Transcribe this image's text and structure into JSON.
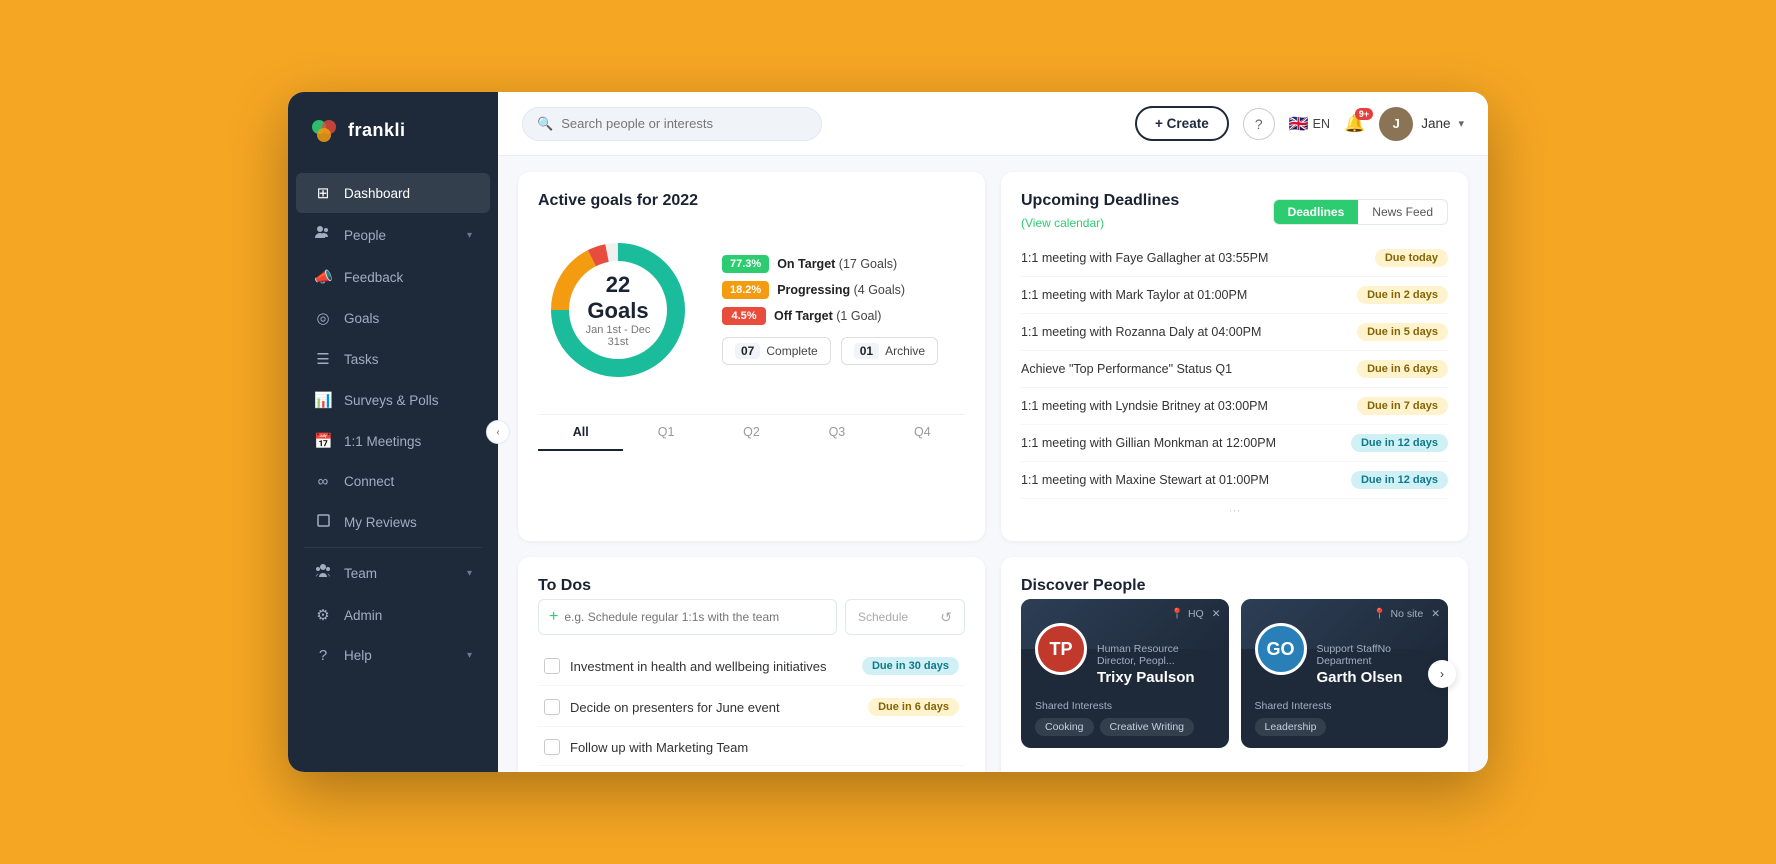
{
  "app": {
    "name": "frankli"
  },
  "header": {
    "search_placeholder": "Search people or interests",
    "create_label": "+ Create",
    "help_label": "?",
    "lang": "EN",
    "notifications_count": "9+",
    "user_name": "Jane"
  },
  "sidebar": {
    "items": [
      {
        "id": "dashboard",
        "label": "Dashboard",
        "icon": "⊞",
        "active": true
      },
      {
        "id": "people",
        "label": "People",
        "icon": "👥",
        "arrow": true
      },
      {
        "id": "feedback",
        "label": "Feedback",
        "icon": "📣"
      },
      {
        "id": "goals",
        "label": "Goals",
        "icon": "◎"
      },
      {
        "id": "tasks",
        "label": "Tasks",
        "icon": "☰"
      },
      {
        "id": "surveys",
        "label": "Surveys & Polls",
        "icon": "📊"
      },
      {
        "id": "meetings",
        "label": "1:1 Meetings",
        "icon": "📅"
      },
      {
        "id": "connect",
        "label": "Connect",
        "icon": "∞"
      },
      {
        "id": "reviews",
        "label": "My Reviews",
        "icon": "👤"
      },
      {
        "id": "team",
        "label": "Team",
        "icon": "👫",
        "arrow": true
      },
      {
        "id": "admin",
        "label": "Admin",
        "icon": "⚙"
      },
      {
        "id": "help",
        "label": "Help",
        "icon": "?",
        "arrow": true
      }
    ]
  },
  "goals_card": {
    "title": "Active goals for 2022",
    "total": "22 Goals",
    "period": "Jan 1st - Dec 31st",
    "legend": [
      {
        "pct": "77.3%",
        "label": "On Target",
        "count": "17 Goals",
        "color": "green"
      },
      {
        "pct": "18.2%",
        "label": "Progressing",
        "count": "4 Goals",
        "color": "orange"
      },
      {
        "pct": "4.5%",
        "label": "Off Target",
        "count": "1 Goal",
        "color": "red"
      }
    ],
    "complete_count": "07",
    "complete_label": "Complete",
    "archive_count": "01",
    "archive_label": "Archive",
    "tabs": [
      "All",
      "Q1",
      "Q2",
      "Q3",
      "Q4"
    ],
    "active_tab": "All"
  },
  "deadlines_card": {
    "title": "Upcoming Deadlines",
    "view_calendar": "(View calendar)",
    "tabs": [
      "Deadlines",
      "News Feed"
    ],
    "active_tab": "Deadlines",
    "items": [
      {
        "text": "1:1 meeting with Faye Gallagher at 03:55PM",
        "due": "Due today",
        "due_class": "due-today"
      },
      {
        "text": "1:1 meeting with Mark Taylor at 01:00PM",
        "due": "Due in 2 days",
        "due_class": "due-2days"
      },
      {
        "text": "1:1 meeting with Rozanna Daly at 04:00PM",
        "due": "Due in 5 days",
        "due_class": "due-5days"
      },
      {
        "text": "Achieve \"Top Performance\" Status Q1",
        "due": "Due in 6 days",
        "due_class": "due-6days"
      },
      {
        "text": "1:1 meeting with Lyndsie Britney at 03:00PM",
        "due": "Due in 7 days",
        "due_class": "due-7days"
      },
      {
        "text": "1:1 meeting with Gillian Monkman at 12:00PM",
        "due": "Due in 12 days",
        "due_class": "due-12days"
      },
      {
        "text": "1:1 meeting with Maxine Stewart at 01:00PM",
        "due": "Due in 12 days",
        "due_class": "due-12days"
      }
    ]
  },
  "todos_card": {
    "title": "To Dos",
    "input_placeholder": "e.g. Schedule regular 1:1s with the team",
    "schedule_placeholder": "Schedule",
    "items": [
      {
        "text": "Investment in health and wellbeing initiatives",
        "due": "Due in 30 days",
        "due_class": "todo-due-30"
      },
      {
        "text": "Decide on presenters for June event",
        "due": "Due in 6 days",
        "due_class": "todo-due-6"
      },
      {
        "text": "Follow up with Marketing Team",
        "due": "",
        "due_class": ""
      }
    ]
  },
  "discover_card": {
    "title": "Discover People",
    "people": [
      {
        "name": "Trixy Paulson",
        "role": "Human Resource Director, Peopl...",
        "location": "HQ",
        "avatar_initials": "TP",
        "avatar_color": "red",
        "interests_label": "Shared Interests",
        "interests": [
          "Cooking",
          "Creative Writing"
        ]
      },
      {
        "name": "Garth Olsen",
        "role": "Support StaffNo Department",
        "location": "No site",
        "avatar_initials": "GO",
        "avatar_color": "blue",
        "interests_label": "Shared Interests",
        "interests": [
          "Leadership"
        ]
      }
    ]
  }
}
